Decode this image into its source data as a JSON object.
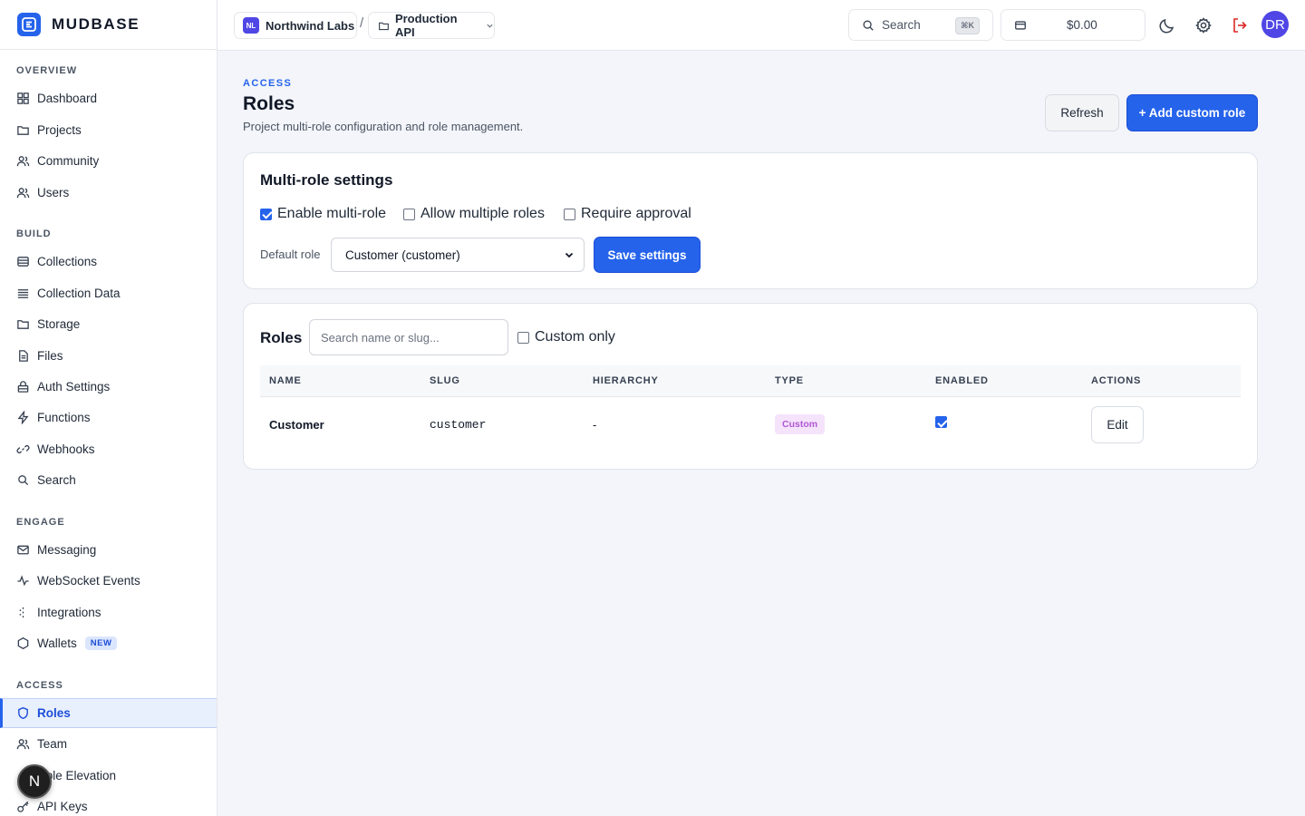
{
  "app": {
    "name": "MUDBASE"
  },
  "sidebar": {
    "sections": [
      {
        "label": "OVERVIEW",
        "items": [
          {
            "label": "Dashboard",
            "icon": "grid-icon"
          },
          {
            "label": "Projects",
            "icon": "folder-icon"
          },
          {
            "label": "Community",
            "icon": "users-icon"
          },
          {
            "label": "Users",
            "icon": "users-icon"
          }
        ]
      },
      {
        "label": "BUILD",
        "items": [
          {
            "label": "Collections",
            "icon": "database-icon"
          },
          {
            "label": "Collection Data",
            "icon": "list-icon"
          },
          {
            "label": "Storage",
            "icon": "folder-icon"
          },
          {
            "label": "Files",
            "icon": "file-icon"
          },
          {
            "label": "Auth Settings",
            "icon": "lock-icon"
          },
          {
            "label": "Functions",
            "icon": "bolt-icon"
          },
          {
            "label": "Webhooks",
            "icon": "link-icon"
          },
          {
            "label": "Search",
            "icon": "search-icon"
          }
        ]
      },
      {
        "label": "ENGAGE",
        "items": [
          {
            "label": "Messaging",
            "icon": "mail-icon"
          },
          {
            "label": "WebSocket Events",
            "icon": "activity-icon"
          },
          {
            "label": "Integrations",
            "icon": "sparkle-icon"
          },
          {
            "label": "Wallets",
            "icon": "hexagon-icon",
            "badge": "NEW"
          }
        ]
      },
      {
        "label": "ACCESS",
        "items": [
          {
            "label": "Roles",
            "icon": "shield-icon",
            "active": true
          },
          {
            "label": "Team",
            "icon": "users-icon"
          },
          {
            "label": "Role Elevation",
            "icon": "arrow-up-icon"
          },
          {
            "label": "API Keys",
            "icon": "key-icon"
          }
        ]
      }
    ],
    "floating_badge": "N"
  },
  "header": {
    "org": {
      "initials": "NL",
      "name": "Northwind Labs"
    },
    "separator": "/",
    "project": {
      "name": "Production API"
    },
    "search": {
      "label": "Search",
      "shortcut": "⌘K"
    },
    "wallet": {
      "balance": "$0.00"
    },
    "avatar_initials": "DR"
  },
  "page": {
    "eyebrow": "ACCESS",
    "title": "Roles",
    "subtitle": "Project multi-role configuration and role management.",
    "refresh_label": "Refresh",
    "add_label": "+ Add custom role"
  },
  "settings": {
    "title": "Multi-role settings",
    "enable_multi_role": {
      "label": "Enable multi-role",
      "checked": true
    },
    "allow_multiple_roles": {
      "label": "Allow multiple roles",
      "checked": false
    },
    "require_approval": {
      "label": "Require approval",
      "checked": false
    },
    "default_role_label": "Default role",
    "default_role_value": "Customer (customer)",
    "save_label": "Save settings"
  },
  "roles": {
    "title": "Roles",
    "search_placeholder": "Search name or slug...",
    "custom_only": {
      "label": "Custom only",
      "checked": false
    },
    "columns": [
      "NAME",
      "SLUG",
      "HIERARCHY",
      "TYPE",
      "ENABLED",
      "ACTIONS"
    ],
    "rows": [
      {
        "name": "Customer",
        "slug": "customer",
        "hierarchy": "-",
        "type": "Custom",
        "enabled": true,
        "action": "Edit"
      }
    ]
  },
  "colors": {
    "accent": "#2563eb",
    "active_bg": "#e8effd",
    "custom_pill": "#f5e3fb"
  }
}
